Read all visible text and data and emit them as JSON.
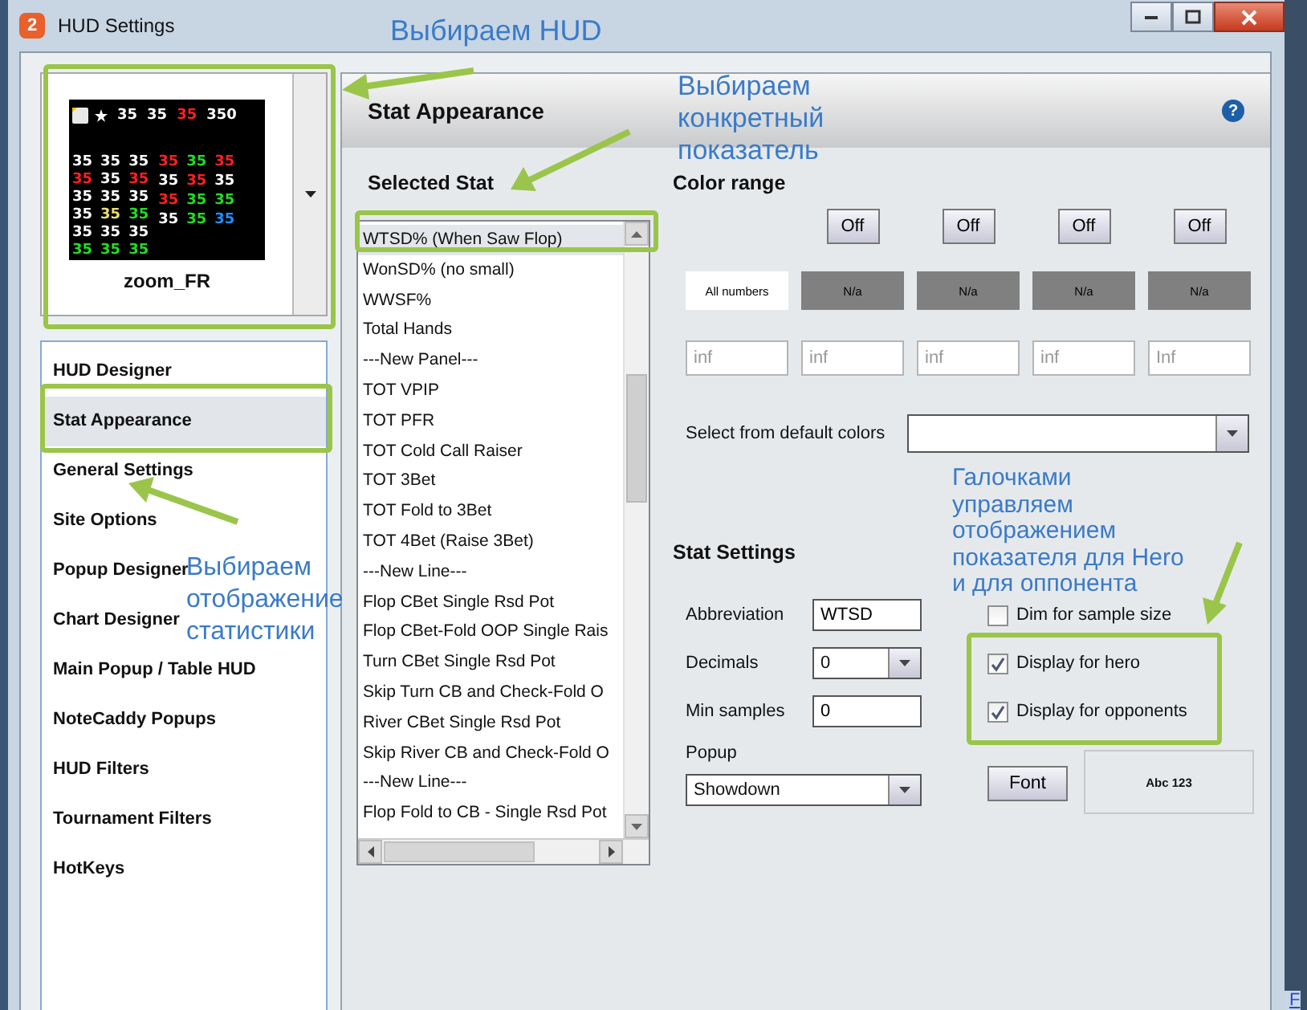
{
  "window": {
    "logo": "2",
    "title": "HUD Settings"
  },
  "hud_preview": {
    "name": "zoom_FR",
    "top_row": [
      {
        "text": "35",
        "color": "#ffffff"
      },
      {
        "text": "35",
        "color": "#ffffff"
      },
      {
        "text": "35",
        "color": "#ff2020"
      },
      {
        "text": "350",
        "color": "#ffffff"
      }
    ],
    "left_rows": [
      [
        {
          "text": "35",
          "color": "#ffffff"
        },
        {
          "text": "35",
          "color": "#ffffff"
        },
        {
          "text": "35",
          "color": "#ffffff"
        }
      ],
      [
        {
          "text": "35",
          "color": "#ff2020"
        },
        {
          "text": "35",
          "color": "#ffffff"
        },
        {
          "text": "35",
          "color": "#ff2020"
        }
      ],
      [
        {
          "text": "35",
          "color": "#ffffff"
        },
        {
          "text": "35",
          "color": "#ffffff"
        },
        {
          "text": "35",
          "color": "#ffffff"
        }
      ],
      [
        {
          "text": "35",
          "color": "#ffffff"
        },
        {
          "text": "35",
          "color": "#e8e070"
        },
        {
          "text": "35",
          "color": "#22dd22"
        }
      ],
      [
        {
          "text": "35",
          "color": "#ffffff"
        },
        {
          "text": "35",
          "color": "#ffffff"
        },
        {
          "text": "35",
          "color": "#ffffff"
        }
      ],
      [
        {
          "text": "35",
          "color": "#22dd22"
        },
        {
          "text": "35",
          "color": "#22dd22"
        },
        {
          "text": "35",
          "color": "#22dd22"
        }
      ]
    ],
    "right_rows": [
      [
        {
          "text": "35",
          "color": "#ff2020"
        },
        {
          "text": "35",
          "color": "#22dd22"
        },
        {
          "text": "35",
          "color": "#ff2020"
        }
      ],
      [
        {
          "text": "35",
          "color": "#ffffff"
        },
        {
          "text": "35",
          "color": "#ff2020"
        },
        {
          "text": "35",
          "color": "#ffffff"
        }
      ],
      [
        {
          "text": "35",
          "color": "#ff2020"
        },
        {
          "text": "35",
          "color": "#22dd22"
        },
        {
          "text": "35",
          "color": "#22dd22"
        }
      ],
      [
        {
          "text": "35",
          "color": "#ffffff"
        },
        {
          "text": "35",
          "color": "#22dd22"
        },
        {
          "text": "35",
          "color": "#1e90ff"
        }
      ]
    ]
  },
  "sidebar": {
    "items": [
      {
        "label": "HUD Designer",
        "selected": false
      },
      {
        "label": "Stat Appearance",
        "selected": true
      },
      {
        "label": "General Settings",
        "selected": false
      },
      {
        "label": "Site Options",
        "selected": false
      },
      {
        "label": "Popup Designer",
        "selected": false
      },
      {
        "label": "Chart Designer",
        "selected": false
      },
      {
        "label": "Main Popup / Table HUD",
        "selected": false
      },
      {
        "label": "NoteCaddy Popups",
        "selected": false
      },
      {
        "label": "HUD Filters",
        "selected": false
      },
      {
        "label": "Tournament Filters",
        "selected": false
      },
      {
        "label": "HotKeys",
        "selected": false
      }
    ]
  },
  "panel": {
    "title": "Stat Appearance",
    "help": "?"
  },
  "selected_stat": {
    "title": "Selected Stat",
    "items": [
      {
        "label": "WTSD% (When Saw Flop)",
        "selected": true
      },
      {
        "label": "WonSD% (no small)",
        "selected": false
      },
      {
        "label": "WWSF%",
        "selected": false
      },
      {
        "label": "Total Hands",
        "selected": false
      },
      {
        "label": "---New Panel---",
        "selected": false
      },
      {
        "label": "TOT VPIP",
        "selected": false
      },
      {
        "label": "TOT PFR",
        "selected": false
      },
      {
        "label": "TOT Cold Call Raiser",
        "selected": false
      },
      {
        "label": "TOT 3Bet",
        "selected": false
      },
      {
        "label": "TOT Fold to 3Bet",
        "selected": false
      },
      {
        "label": "TOT 4Bet (Raise 3Bet)",
        "selected": false
      },
      {
        "label": "---New Line---",
        "selected": false
      },
      {
        "label": "Flop CBet Single Rsd Pot",
        "selected": false
      },
      {
        "label": "Flop CBet-Fold OOP Single Rais",
        "selected": false
      },
      {
        "label": "Turn CBet Single Rsd Pot",
        "selected": false
      },
      {
        "label": "Skip Turn CB and Check-Fold O",
        "selected": false
      },
      {
        "label": "River CBet Single Rsd Pot",
        "selected": false
      },
      {
        "label": "Skip River CB and Check-Fold O",
        "selected": false
      },
      {
        "label": "---New Line---",
        "selected": false
      },
      {
        "label": "Flop Fold to CB - Single Rsd Pot",
        "selected": false
      }
    ]
  },
  "color_range": {
    "title": "Color range",
    "columns": [
      {
        "swatch": "All numbers",
        "color": "#ffffff",
        "placeholder": "inf"
      },
      {
        "button": "Off",
        "swatch": "N/a",
        "color": "#808080",
        "placeholder": "inf"
      },
      {
        "button": "Off",
        "swatch": "N/a",
        "color": "#808080",
        "placeholder": "inf"
      },
      {
        "button": "Off",
        "swatch": "N/a",
        "color": "#808080",
        "placeholder": "inf"
      },
      {
        "button": "Off",
        "swatch": "N/a",
        "color": "#808080",
        "placeholder": "Inf"
      }
    ],
    "default_colors_label": "Select from default colors"
  },
  "stat_settings": {
    "title": "Stat Settings",
    "abbreviation": {
      "label": "Abbreviation",
      "value": "WTSD"
    },
    "decimals": {
      "label": "Decimals",
      "value": "0"
    },
    "min_samples": {
      "label": "Min samples",
      "value": "0"
    },
    "popup": {
      "label": "Popup",
      "value": "Showdown"
    },
    "checkboxes": [
      {
        "label": "Dim for sample size",
        "checked": false
      },
      {
        "label": "Display for hero",
        "checked": true
      },
      {
        "label": "Display for opponents",
        "checked": true
      }
    ],
    "font_button": "Font",
    "font_preview": "Abc 123"
  },
  "annotations": [
    "Выбираем HUD",
    "Выбираем\nконкретный\nпоказатель",
    "Выбираем\nотображение\nстатистики",
    "Галочками\nуправляем\nотображением\nпоказателя для Hero\nи для оппонента"
  ],
  "background_link": "F"
}
